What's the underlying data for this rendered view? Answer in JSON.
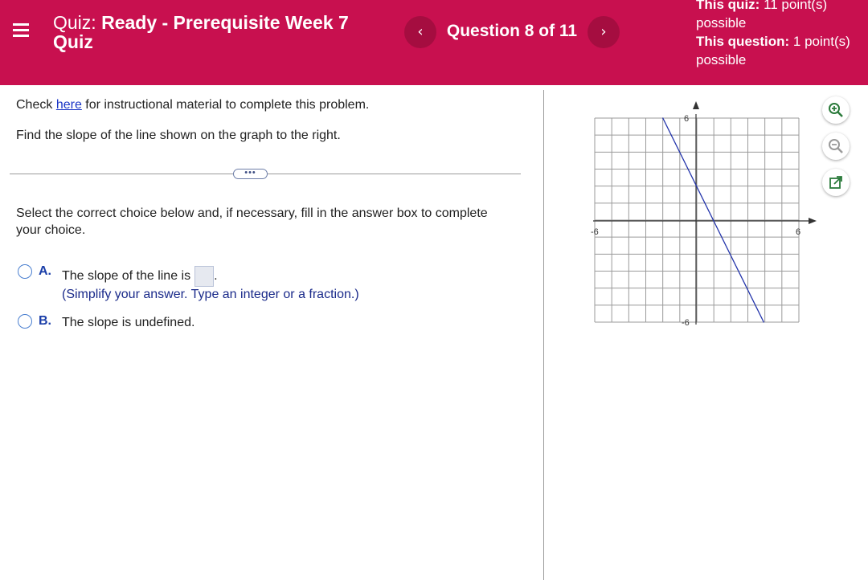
{
  "header": {
    "quiz_prefix": "Quiz:",
    "quiz_name": "Ready - Prerequisite Week 7 Quiz",
    "prev_label": "‹",
    "next_label": "›",
    "question_counter": "Question 8 of 11",
    "quiz_points_label": "This quiz:",
    "quiz_points_value": "11 point(s) possible",
    "question_points_label": "This question:",
    "question_points_value": "1 point(s) possible"
  },
  "problem": {
    "check_prefix": "Check",
    "check_link": "here",
    "check_suffix": "for instructional material to complete this problem.",
    "prompt": "Find the slope of the line shown on the graph to the right.",
    "more_label": "•••",
    "instruction": "Select the correct choice below and, if necessary, fill in the answer box to complete your choice."
  },
  "choices": {
    "a_letter": "A.",
    "a_text": "The slope of the line is",
    "a_after_box": ".",
    "a_hint": "(Simplify your answer. Type an integer or a fraction.)",
    "b_letter": "B.",
    "b_text": "The slope is undefined."
  },
  "graph": {
    "x_min_label": "-6",
    "x_max_label": "6",
    "y_max_label": "6",
    "y_min_label": "-6"
  },
  "colors": {
    "header_bg": "#c8104f",
    "line": "#2233aa",
    "link": "#1a35c6"
  },
  "tools": [
    "zoom-in-icon",
    "zoom-out-icon",
    "popout-icon"
  ]
}
